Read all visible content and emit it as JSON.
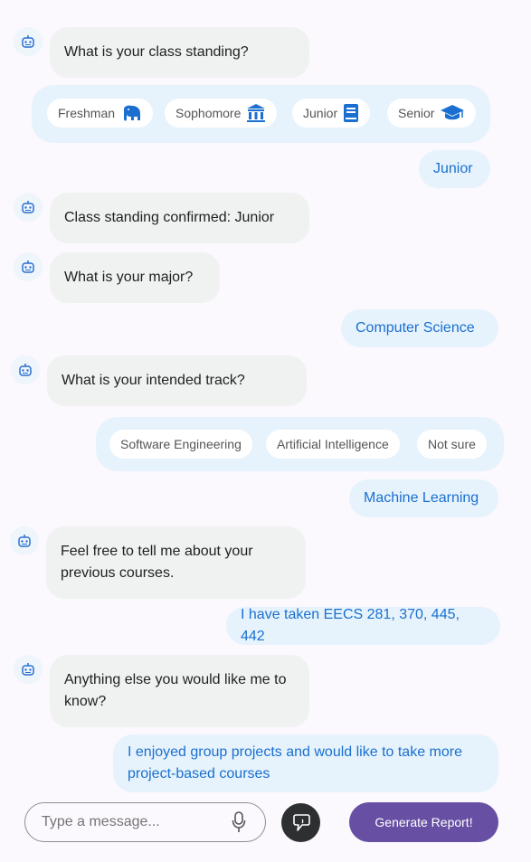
{
  "messages": {
    "q1": "What is your class standing?",
    "standing_options": [
      {
        "label": "Freshman",
        "icon": "elephant-icon"
      },
      {
        "label": "Sophomore",
        "icon": "museum-icon"
      },
      {
        "label": "Junior",
        "icon": "book-icon"
      },
      {
        "label": "Senior",
        "icon": "graduation-cap-icon"
      }
    ],
    "a1": "Junior",
    "bot_confirm": "Class standing confirmed: Junior",
    "q2": "What is your major?",
    "a2": "Computer Science",
    "q3": "What is your intended track?",
    "track_options": [
      "Software Engineering",
      "Artificial Intelligence",
      "Not sure"
    ],
    "a3": "Machine Learning",
    "q4": "Feel free to tell me about your previous courses.",
    "a4": "I have taken EECS 281, 370, 445, 442",
    "q5": "Anything else you would like me to know?",
    "a5": "I enjoyed group projects and would like to take more project-based courses"
  },
  "composer": {
    "placeholder": "Type a message...",
    "generate_label": "Generate Report!"
  },
  "colors": {
    "accent": "#1a6fd0",
    "user_bubble": "#e6f3fc",
    "bot_bubble": "#f0f2f2",
    "primary_button": "#6750a4"
  }
}
